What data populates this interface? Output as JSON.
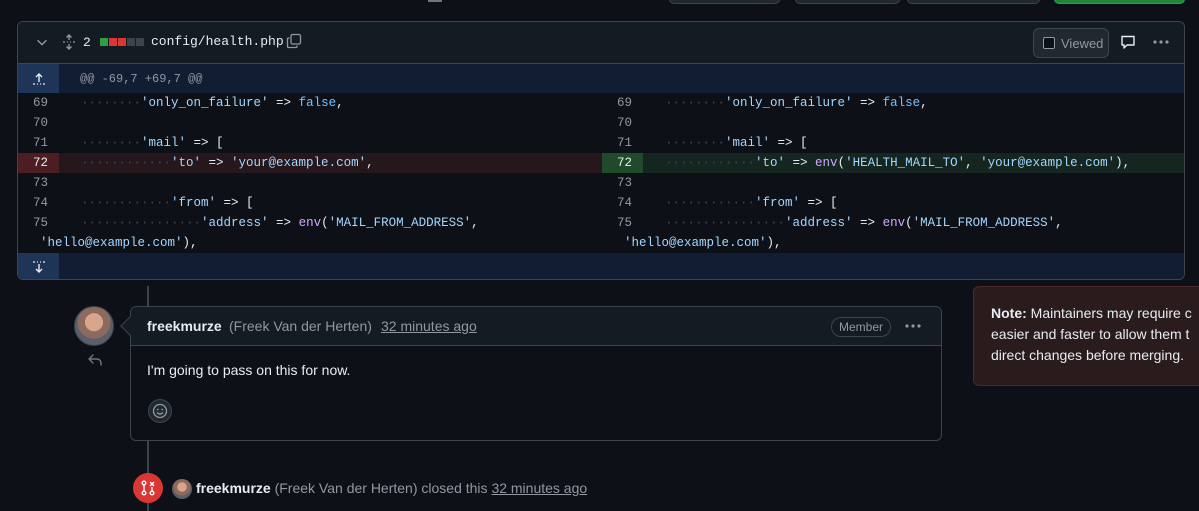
{
  "file": {
    "change_count": "2",
    "filename": "config/health.php",
    "viewed_label": "Viewed",
    "hunk_header": "@@ -69,7 +69,7 @@",
    "diff_colors": {
      "added": "#2ea043",
      "removed": "#da3633",
      "neutral": "#3d444d"
    }
  },
  "diff": {
    "rows": [
      {
        "ln_left": "69",
        "ln_right": "69"
      },
      {
        "ln_left": "70",
        "ln_right": "70"
      },
      {
        "ln_left": "71",
        "ln_right": "71"
      },
      {
        "ln_left": "72",
        "ln_right": "72"
      },
      {
        "ln_left": "73",
        "ln_right": "73"
      },
      {
        "ln_left": "74",
        "ln_right": "74"
      },
      {
        "ln_left": "75",
        "ln_right": "75"
      }
    ],
    "left": {
      "l69_str": "'only_on_failure'",
      "l69_op": " => ",
      "l69_val": "false",
      "l69_end": ",",
      "l71_str": "'mail'",
      "l71_op": " => [",
      "l72_str": "'to'",
      "l72_op": " => ",
      "l72_val": "'your@example.com'",
      "l72_end": ",",
      "l74_str": "'from'",
      "l74_op": " => [",
      "l75_str": "'address'",
      "l75_op": " => ",
      "l75_fn": "env",
      "l75_arg": "'MAIL_FROM_ADDRESS'",
      "l75_end": ",",
      "l75_wrap": "'hello@example.com'",
      "l75_wrap_end": "),"
    },
    "right": {
      "l69_str": "'only_on_failure'",
      "l69_op": " => ",
      "l69_val": "false",
      "l69_end": ",",
      "l71_str": "'mail'",
      "l71_op": " => [",
      "l72_str": "'to'",
      "l72_op": " => ",
      "l72_fn": "env",
      "l72_arg1": "'HEALTH_MAIL_TO'",
      "l72_sep": ", ",
      "l72_arg2": "'your@example.com'",
      "l72_end": "),",
      "l74_str": "'from'",
      "l74_op": " => [",
      "l75_str": "'address'",
      "l75_op": " => ",
      "l75_fn": "env",
      "l75_arg": "'MAIL_FROM_ADDRESS'",
      "l75_end": ",",
      "l75_wrap": "'hello@example.com'",
      "l75_wrap_end": "),"
    }
  },
  "comment": {
    "author": "freekmurze",
    "full_name": "(Freek Van der Herten)",
    "time": "32 minutes ago",
    "badge": "Member",
    "body": "I'm going to pass on this for now."
  },
  "event": {
    "author": "freekmurze",
    "full_name": "(Freek Van der Herten)",
    "action": "closed this",
    "time": "32 minutes ago"
  },
  "note": {
    "label": "Note:",
    "line1": "Maintainers may require c",
    "line2": "easier and faster to allow them t",
    "line3": "direct changes before merging."
  }
}
